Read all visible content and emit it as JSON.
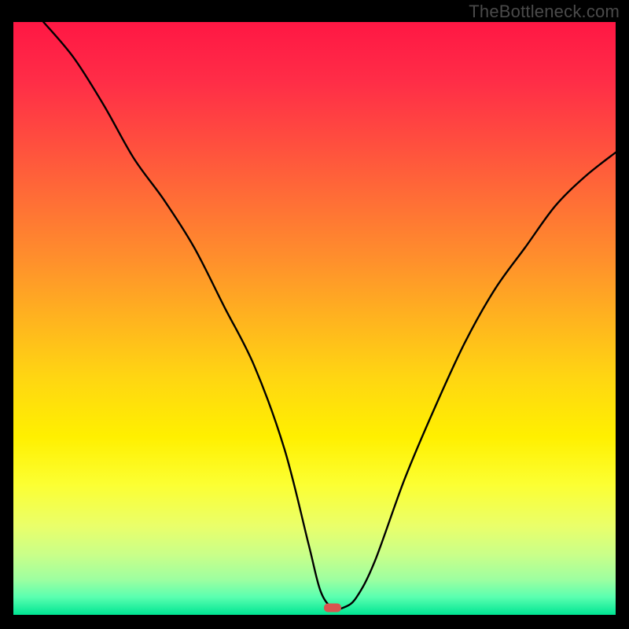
{
  "watermark": "TheBottleneck.com",
  "colors": {
    "frame": "#000000",
    "curve": "#000000",
    "marker_fill": "#d9534f",
    "watermark_text": "#4a4a4a",
    "gradient_stops": [
      {
        "offset": 0.0,
        "color": "#ff1744"
      },
      {
        "offset": 0.1,
        "color": "#ff2d47"
      },
      {
        "offset": 0.2,
        "color": "#ff4d3f"
      },
      {
        "offset": 0.3,
        "color": "#ff6e36"
      },
      {
        "offset": 0.4,
        "color": "#ff8f2c"
      },
      {
        "offset": 0.5,
        "color": "#ffb31f"
      },
      {
        "offset": 0.6,
        "color": "#ffd612"
      },
      {
        "offset": 0.7,
        "color": "#fff000"
      },
      {
        "offset": 0.78,
        "color": "#fcff32"
      },
      {
        "offset": 0.85,
        "color": "#eaff6a"
      },
      {
        "offset": 0.9,
        "color": "#c8ff8a"
      },
      {
        "offset": 0.94,
        "color": "#9effa0"
      },
      {
        "offset": 0.97,
        "color": "#5affb0"
      },
      {
        "offset": 1.0,
        "color": "#00e593"
      }
    ]
  },
  "chart_data": {
    "type": "line",
    "title": "",
    "xlabel": "",
    "ylabel": "",
    "xlim": [
      0,
      100
    ],
    "ylim": [
      0,
      100
    ],
    "marker": {
      "x": 53,
      "y": 1.2
    },
    "series": [
      {
        "name": "bottleneck-curve",
        "x": [
          5,
          10,
          15,
          20,
          25,
          30,
          35,
          40,
          45,
          49,
          51,
          53,
          55,
          57,
          60,
          65,
          70,
          75,
          80,
          85,
          90,
          95,
          100
        ],
        "values": [
          100,
          94,
          86,
          77,
          70,
          62,
          52,
          42,
          28,
          12,
          4,
          1.2,
          1.3,
          3,
          9,
          23,
          35,
          46,
          55,
          62,
          69,
          74,
          78
        ]
      }
    ]
  }
}
